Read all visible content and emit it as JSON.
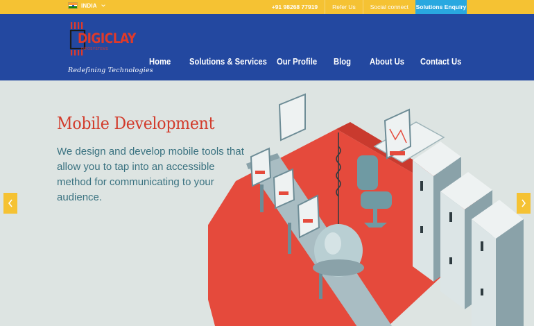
{
  "topbar": {
    "country": "INDIA",
    "links": [
      "+91 98268 77919",
      "Refer Us",
      "Social connect"
    ],
    "enquiry": "Solutions Enquiry"
  },
  "header": {
    "logo_text": "DIGICLAY",
    "logo_sub": "INFOSYSTEMS",
    "tagline": "Redefining Technologies",
    "nav": [
      "Home",
      "Solutions & Services",
      "Our Profile",
      "Blog",
      "About Us",
      "Contact Us"
    ]
  },
  "hero": {
    "title": "Mobile Development",
    "description": "We design and develop mobile tools that allow you to tap into an accessible method for communicating to your audience."
  },
  "colors": {
    "topbar": "#f5c233",
    "header": "#2348a0",
    "enquiry": "#29a8e0",
    "hero_title": "#d23a2a",
    "hero_text": "#3a7280"
  },
  "icons": {
    "flag": "india-flag-icon",
    "chevron": "chevron-down-icon",
    "prev": "chevron-left-icon",
    "next": "chevron-right-icon"
  }
}
